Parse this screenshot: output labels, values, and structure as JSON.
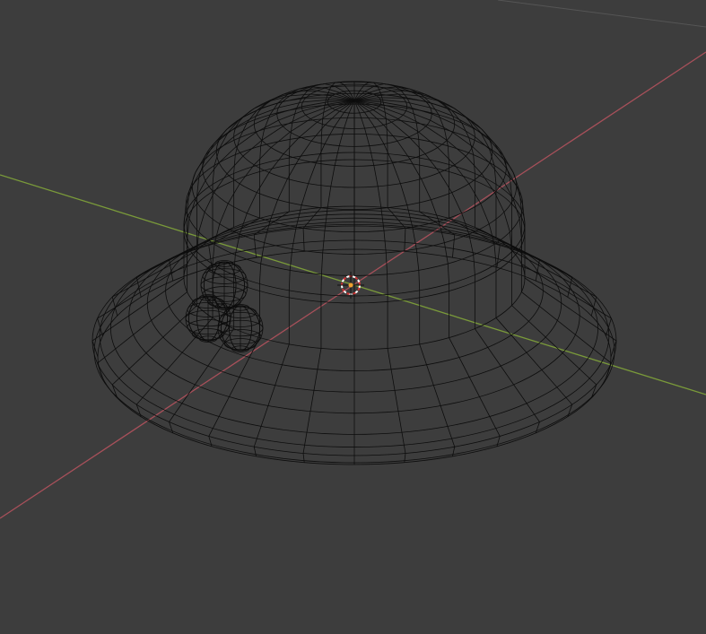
{
  "viewport": {
    "background": "#3d3d3d",
    "wire_color": "#0d0d0d",
    "x_axis_color": "#a8505a",
    "y_axis_color": "#7a9a3a",
    "grid_line_color": "#505050",
    "cursor_ring_colors": [
      "#ffffff",
      "#d03030"
    ],
    "origin_color": "#f0a030"
  }
}
